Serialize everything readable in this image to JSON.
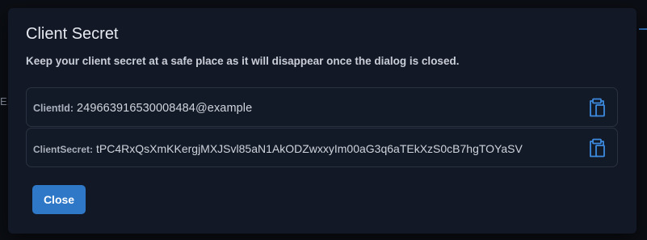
{
  "background": {
    "peek_text": "E."
  },
  "dialog": {
    "title": "Client Secret",
    "description": "Keep your client secret at a safe place as it will disappear once the dialog is closed.",
    "fields": [
      {
        "label": "ClientId:",
        "value": "249663916530008484@example",
        "icon": "clipboard-icon"
      },
      {
        "label": "ClientSecret:",
        "value": "tPC4RxQsXmKKergjMXJSvl85aN1AkODZwxxyIm00aG3q6aTEkXzS0cB7hgTOYaSV",
        "icon": "clipboard-icon"
      }
    ],
    "close_label": "Close"
  },
  "colors": {
    "accent": "#2f78c8",
    "dialog_bg": "#121826",
    "page_bg": "#0b0e14"
  }
}
